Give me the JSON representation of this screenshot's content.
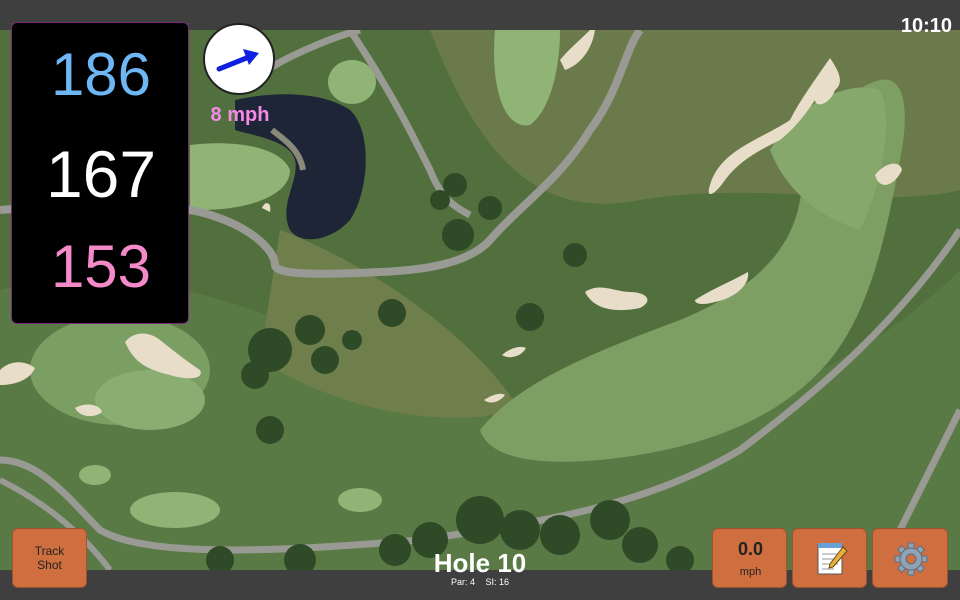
{
  "status": {
    "time": "10:10"
  },
  "distances": {
    "back": "186",
    "center": "167",
    "front": "153",
    "back_color": "#6fb6f5",
    "center_color": "#ffffff",
    "front_color": "#f58ac8"
  },
  "wind": {
    "speed": "8 mph",
    "icon": "arrow-right-icon",
    "arrow_color": "#1020e0",
    "text_color": "#f58ae8"
  },
  "buttons": {
    "track_shot": {
      "line1": "Track",
      "line2": "Shot"
    },
    "speed": {
      "value": "0.0",
      "unit": "mph"
    },
    "notes": {
      "icon": "notepad-icon"
    },
    "settings": {
      "icon": "gear-icon"
    },
    "button_color": "#cf6e3f"
  },
  "hole": {
    "title": "Hole 10",
    "par": "Par: 4",
    "stroke_index": "SI: 16"
  },
  "map": {
    "view": "satellite"
  }
}
